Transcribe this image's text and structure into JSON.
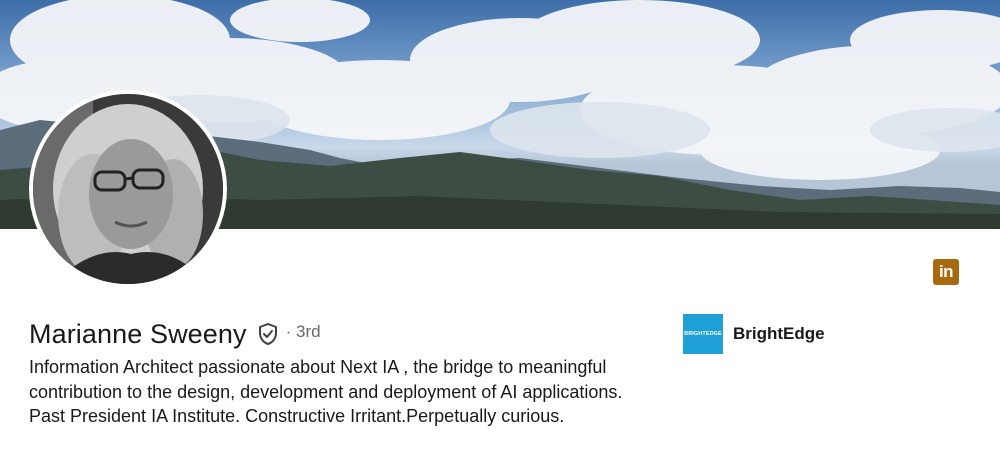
{
  "banner": {
    "icon": "mountain-landscape-banner"
  },
  "avatar": {
    "icon": "profile-photo"
  },
  "badge": {
    "text": "in",
    "color": "#a76a0e"
  },
  "profile": {
    "name": "Marianne Sweeny",
    "verified_icon": "shield-check-icon",
    "degree": "· 3rd",
    "headline": "Information Architect passionate about Next IA , the bridge to meaningful contribution to the design, development and deployment of AI applications. Past President IA Institute. Constructive Irritant.Perpetually curious."
  },
  "company": {
    "logo_text": "BRIGHTEDGE",
    "logo_color": "#1fa1d8",
    "name": "BrightEdge"
  }
}
